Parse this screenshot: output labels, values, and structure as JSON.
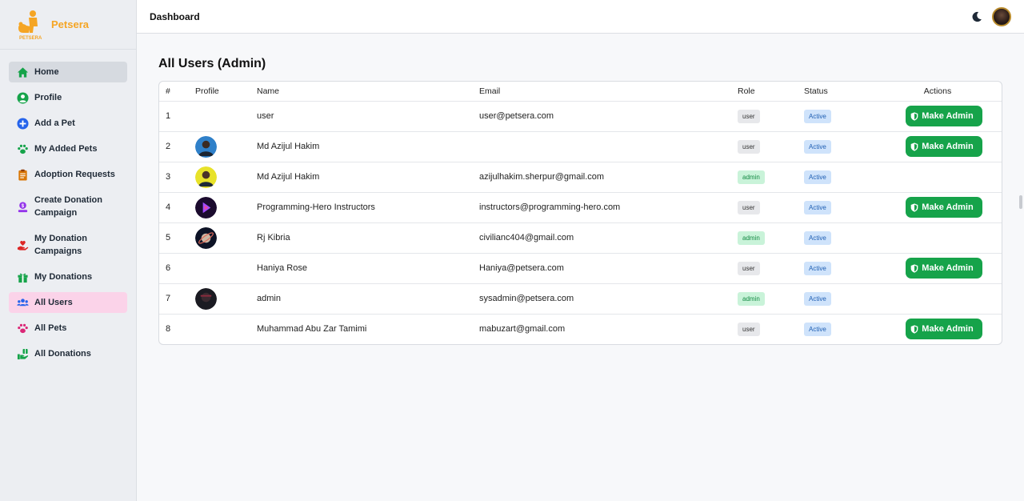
{
  "brand": {
    "name": "Petsera"
  },
  "header": {
    "title": "Dashboard"
  },
  "sidebar": {
    "items": [
      {
        "label": "Home",
        "icon": "home-icon",
        "active": "gray"
      },
      {
        "label": "Profile",
        "icon": "user-circle-icon"
      },
      {
        "label": "Add a Pet",
        "icon": "plus-circle-icon"
      },
      {
        "label": "My Added Pets",
        "icon": "paw-icon"
      },
      {
        "label": "Adoption Requests",
        "icon": "clipboard-icon"
      },
      {
        "label": "Create Donation Campaign",
        "icon": "donate-icon"
      },
      {
        "label": "My Donation Campaigns",
        "icon": "hand-heart-icon"
      },
      {
        "label": "My Donations",
        "icon": "gift-icon"
      },
      {
        "label": "All Users",
        "icon": "users-icon",
        "active": "pink"
      },
      {
        "label": "All Pets",
        "icon": "paw-icon"
      },
      {
        "label": "All Donations",
        "icon": "hand-holding-icon"
      }
    ]
  },
  "main": {
    "title": "All Users (Admin)",
    "table": {
      "headers": {
        "num": "#",
        "profile": "Profile",
        "name": "Name",
        "email": "Email",
        "role": "Role",
        "status": "Status",
        "actions": "Actions"
      },
      "rows": [
        {
          "num": "1",
          "name": "user",
          "email": "user@petsera.com",
          "role": "user",
          "status": "Active",
          "action": "Make Admin",
          "avatar": ""
        },
        {
          "num": "2",
          "name": "Md Azijul Hakim",
          "email": "",
          "role": "user",
          "status": "Active",
          "action": "Make Admin",
          "avatar": "blue"
        },
        {
          "num": "3",
          "name": "Md Azijul Hakim",
          "email": "azijulhakim.sherpur@gmail.com",
          "role": "admin",
          "status": "Active",
          "action": "",
          "avatar": "yellow"
        },
        {
          "num": "4",
          "name": "Programming-Hero Instructors",
          "email": "instructors@programming-hero.com",
          "role": "user",
          "status": "Active",
          "action": "Make Admin",
          "avatar": "purple"
        },
        {
          "num": "5",
          "name": "Rj Kibria",
          "email": "civilianc404@gmail.com",
          "role": "admin",
          "status": "Active",
          "action": "",
          "avatar": "planet"
        },
        {
          "num": "6",
          "name": "Haniya Rose",
          "email": "Haniya@petsera.com",
          "role": "user",
          "status": "Active",
          "action": "Make Admin",
          "avatar": ""
        },
        {
          "num": "7",
          "name": "admin",
          "email": "sysadmin@petsera.com",
          "role": "admin",
          "status": "Active",
          "action": "",
          "avatar": "dark"
        },
        {
          "num": "8",
          "name": "Muhammad Abu Zar Tamimi",
          "email": "mabuzart@gmail.com",
          "role": "user",
          "status": "Active",
          "action": "Make Admin",
          "avatar": ""
        }
      ]
    }
  },
  "colors": {
    "brand": "#f5a524",
    "make_admin": "#16a34a",
    "active_pink": "#fbd3e9",
    "admin_badge": "#c9f3d9",
    "status_badge": "#cfe3fb"
  }
}
